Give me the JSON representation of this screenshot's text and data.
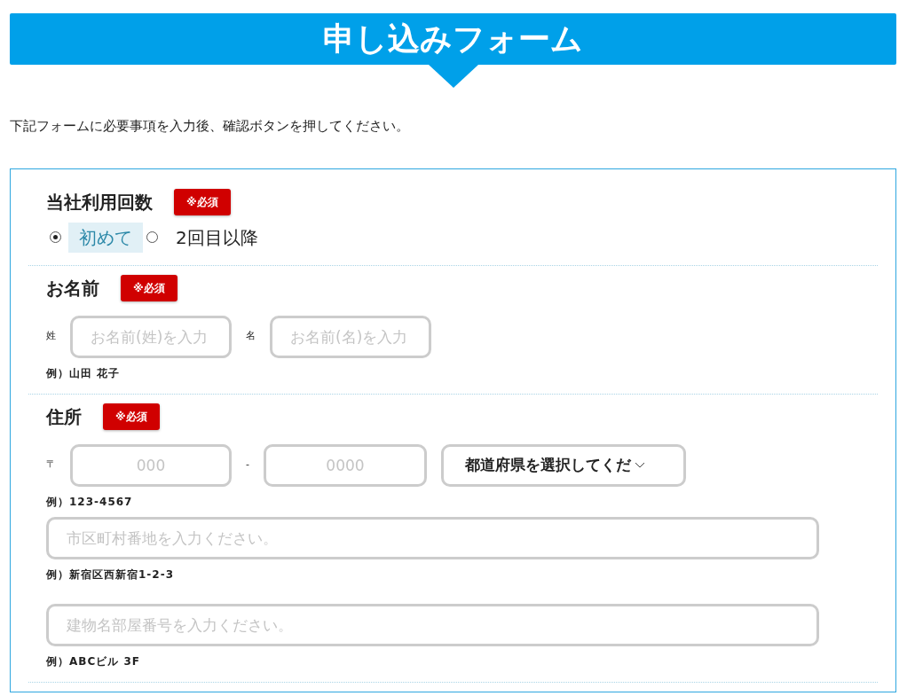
{
  "header": {
    "title": "申し込みフォーム"
  },
  "intro": "下記フォームに必要事項を入力後、確認ボタンを押してください。",
  "sections": [
    {
      "kind": "radio",
      "label": "当社利用回数",
      "required_badge": "※必須",
      "options": [
        {
          "label": "初めて",
          "selected": true
        },
        {
          "label": "2回目以降",
          "selected": false
        }
      ]
    },
    {
      "kind": "name",
      "label": "お名前",
      "required_badge": "※必須",
      "fields": [
        {
          "prefix": "姓",
          "placeholder": "お名前(姓)を入力"
        },
        {
          "prefix": "名",
          "placeholder": "お名前(名)を入力"
        }
      ],
      "example": "例）山田 花子"
    },
    {
      "kind": "address",
      "label": "住所",
      "required_badge": "※必須",
      "postal_prefix": "〒",
      "postal_fields": [
        {
          "placeholder": "000"
        },
        {
          "placeholder": "0000"
        }
      ],
      "postal_separator": "-",
      "prefecture_select": {
        "value": "都道府県を選択してくだ"
      },
      "postal_example": "例）123-4567",
      "lines": [
        {
          "placeholder": "市区町村番地を入力ください。",
          "example": "例）新宿区西新宿1-2-3"
        },
        {
          "placeholder": "建物名部屋番号を入力ください。",
          "example": "例）ABCビル 3F"
        }
      ]
    }
  ]
}
